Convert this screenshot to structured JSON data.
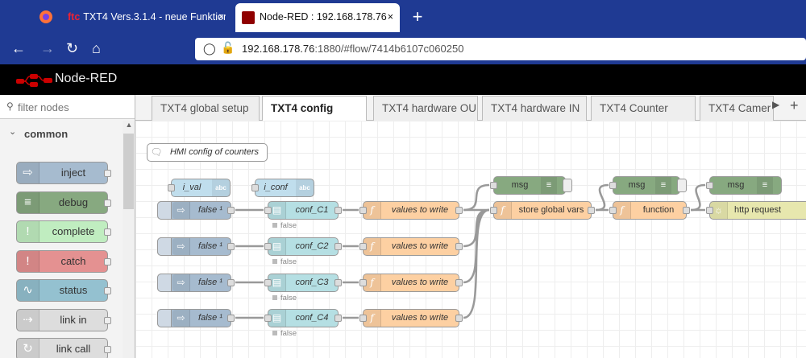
{
  "browser": {
    "tabs": [
      {
        "title": "TXT4 Vers.3.1.4 - neue Funktione"
      },
      {
        "title": "Node-RED : 192.168.178.76"
      }
    ],
    "new_tab_label": "+",
    "url_host": "192.168.178.76",
    "url_rest": ":1880/#flow/7414b6107c060250"
  },
  "app": {
    "name": "Node-RED"
  },
  "palette": {
    "filter_placeholder": "filter nodes",
    "category": "common",
    "nodes": [
      {
        "label": "inject",
        "color": "#a6bbcf",
        "icon": "arrow-right-icon"
      },
      {
        "label": "debug",
        "color": "#87a980",
        "icon": "debug-list-icon"
      },
      {
        "label": "complete",
        "color": "#c0edc0",
        "icon": "exclamation-icon"
      },
      {
        "label": "catch",
        "color": "#e49191",
        "icon": "exclamation-icon"
      },
      {
        "label": "status",
        "color": "#94c1d0",
        "icon": "pulse-icon"
      },
      {
        "label": "link in",
        "color": "#dddddd",
        "icon": "link-in-icon"
      },
      {
        "label": "link call",
        "color": "#dddddd",
        "icon": "link-call-icon"
      }
    ]
  },
  "flow_tabs": [
    "TXT4 global setup",
    "TXT4 config",
    "TXT4 hardware OU",
    "TXT4 hardware IN",
    "TXT4 Counter",
    "TXT4 Camer"
  ],
  "active_tab": "TXT4 config",
  "canvas": {
    "comment": "HMI config of counters",
    "nodes": {
      "i_val": "i_val",
      "i_conf": "i_conf",
      "inject1": "false ¹",
      "inject2": "false ¹",
      "inject3": "false ¹",
      "inject4": "false ¹",
      "conf1": "conf_C1",
      "conf2": "conf_C2",
      "conf3": "conf_C3",
      "conf4": "conf_C4",
      "status1": "false",
      "status2": "false",
      "status3": "false",
      "status4": "false",
      "fn1": "values to write",
      "fn2": "values to write",
      "fn3": "values to write",
      "fn4": "values to write",
      "store": "store global vars",
      "function": "function",
      "http": "http request",
      "msg1": "msg",
      "msg2": "msg",
      "msg3": "msg"
    }
  },
  "colors": {
    "browser": "#1f3a93",
    "inject": "#a6bbcf",
    "ui": "#b5dfe3",
    "function": "#fdd0a2",
    "debug": "#87a980",
    "http": "#e7e7ae"
  }
}
